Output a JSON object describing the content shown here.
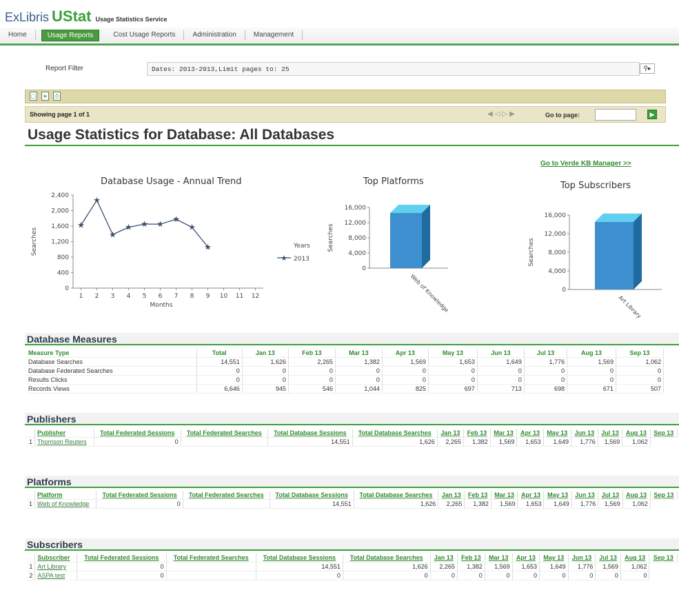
{
  "app": {
    "logo_exlibris": "ExLibris",
    "logo_ustat": "UStat",
    "service": "Usage Statistics Service"
  },
  "nav": [
    {
      "label": "Home",
      "active": false
    },
    {
      "label": "Usage Reports",
      "active": true
    },
    {
      "label": "Cost Usage Reports",
      "active": false
    },
    {
      "label": "Administration",
      "active": false
    },
    {
      "label": "Management",
      "active": false
    }
  ],
  "filter": {
    "label": "Report Filter",
    "value": "Dates: 2013-2013,Limit pages to: 25"
  },
  "pagebar": {
    "showing": "Showing page 1 of 1",
    "goto_label": "Go to page:"
  },
  "report_title": "Usage Statistics for Database: All Databases",
  "verde_link": "Go to Verde KB Manager >>",
  "charts": {
    "trend": {
      "title": "Database Usage - Annual Trend",
      "xlabel": "Months",
      "ylabel": "Searches",
      "legend_title": "Years",
      "legend_item": "2013"
    },
    "platforms": {
      "title": "Top Platforms",
      "ylabel": "Searches",
      "category": "Web of Knowledge"
    },
    "subscribers": {
      "title": "Top Subscribers",
      "ylabel": "Searches",
      "category": "Art Library"
    }
  },
  "chart_data": [
    {
      "type": "line",
      "title": "Database Usage - Annual Trend",
      "xlabel": "Months",
      "ylabel": "Searches",
      "x": [
        1,
        2,
        3,
        4,
        5,
        6,
        7,
        8,
        9
      ],
      "xticks": [
        1,
        2,
        3,
        4,
        5,
        6,
        7,
        8,
        9,
        10,
        11,
        12
      ],
      "ylim": [
        0,
        2400
      ],
      "yticks": [
        "0",
        "400",
        "800",
        "1,200",
        "1,600",
        "2,000",
        "2,400"
      ],
      "series": [
        {
          "name": "2013",
          "values": [
            1626,
            2265,
            1382,
            1569,
            1653,
            1649,
            1776,
            1569,
            1062
          ],
          "color": "#3b4f6b"
        }
      ],
      "legend": "right"
    },
    {
      "type": "bar",
      "title": "Top Platforms",
      "ylabel": "Searches",
      "categories": [
        "Web of Knowledge"
      ],
      "values": [
        14551
      ],
      "ylim": [
        0,
        16000
      ],
      "yticks": [
        "0",
        "4,000",
        "8,000",
        "12,000",
        "16,000"
      ],
      "color": "#3d8fd0"
    },
    {
      "type": "bar",
      "title": "Top Subscribers",
      "ylabel": "Searches",
      "categories": [
        "Art Library"
      ],
      "values": [
        14551
      ],
      "ylim": [
        0,
        16000
      ],
      "yticks": [
        "0",
        "4,000",
        "8,000",
        "12,000",
        "16,000"
      ],
      "color": "#3d8fd0"
    }
  ],
  "measures": {
    "title": "Database Measures",
    "headers": [
      "Measure Type",
      "Total",
      "Jan 13",
      "Feb 13",
      "Mar 13",
      "Apr 13",
      "May 13",
      "Jun 13",
      "Jul 13",
      "Aug 13",
      "Sep 13"
    ],
    "rows": [
      [
        "Database Searches",
        "14,551",
        "1,626",
        "2,265",
        "1,382",
        "1,569",
        "1,653",
        "1,649",
        "1,776",
        "1,569",
        "1,062"
      ],
      [
        "Database Federated Searches",
        "0",
        "0",
        "0",
        "0",
        "0",
        "0",
        "0",
        "0",
        "0",
        "0"
      ],
      [
        "Results Clicks",
        "0",
        "0",
        "0",
        "0",
        "0",
        "0",
        "0",
        "0",
        "0",
        "0"
      ],
      [
        "Records Views",
        "6,646",
        "945",
        "546",
        "1,044",
        "825",
        "697",
        "713",
        "698",
        "671",
        "507"
      ]
    ]
  },
  "publishers": {
    "title": "Publishers",
    "headers": [
      "Publisher",
      "Total Federated Sessions",
      "Total Federated Searches",
      "Total Database Sessions",
      "Total Database Searches",
      "Jan 13",
      "Feb 13",
      "Mar 13",
      "Apr 13",
      "May 13",
      "Jun 13",
      "Jul 13",
      "Aug 13",
      "Sep 13"
    ],
    "rows": [
      [
        "1",
        "Thomson Reuters",
        "",
        "0",
        "",
        "14,551",
        "1,626",
        "2,265",
        "1,382",
        "1,569",
        "1,653",
        "1,649",
        "1,776",
        "1,569",
        "1,062"
      ]
    ]
  },
  "platforms": {
    "title": "Platforms",
    "headers": [
      "Platform",
      "Total Federated Sessions",
      "Total Federated Searches",
      "Total Database Sessions",
      "Total Database Searches",
      "Jan 13",
      "Feb 13",
      "Mar 13",
      "Apr 13",
      "May 13",
      "Jun 13",
      "Jul 13",
      "Aug 13",
      "Sep 13"
    ],
    "rows": [
      [
        "1",
        "Web of Knowledge",
        "",
        "0",
        "",
        "14,551",
        "1,626",
        "2,265",
        "1,382",
        "1,569",
        "1,653",
        "1,649",
        "1,776",
        "1,569",
        "1,062"
      ]
    ]
  },
  "subscribers": {
    "title": "Subscribers",
    "headers": [
      "Subscriber",
      "Total Federated Sessions",
      "Total Federated Searches",
      "Total Database Sessions",
      "Total Database Searches",
      "Jan 13",
      "Feb 13",
      "Mar 13",
      "Apr 13",
      "May 13",
      "Jun 13",
      "Jul 13",
      "Aug 13",
      "Sep 13"
    ],
    "rows": [
      [
        "1",
        "Art Library",
        "",
        "0",
        "",
        "14,551",
        "1,626",
        "2,265",
        "1,382",
        "1,569",
        "1,653",
        "1,649",
        "1,776",
        "1,569",
        "1,062"
      ],
      [
        "2",
        "ASPA test",
        "",
        "0",
        "",
        "0",
        "0",
        "0",
        "0",
        "0",
        "0",
        "0",
        "0",
        "0",
        "0"
      ]
    ]
  }
}
